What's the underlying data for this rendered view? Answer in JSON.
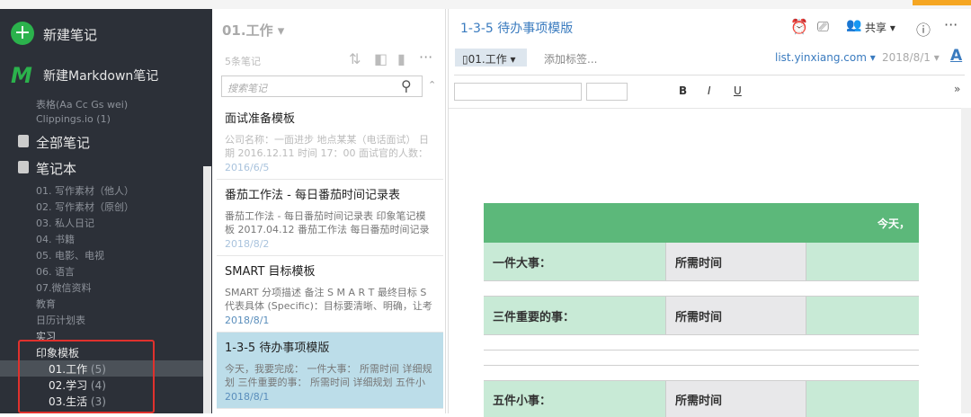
{
  "sidebar": {
    "new_note": "新建笔记",
    "new_markdown": "新建Markdown笔记",
    "shortcuts": [
      "表格(Aa Cc Gs wei)",
      "Clippings.io (1)"
    ],
    "all_notes": "全部笔记",
    "notebooks_label": "笔记本",
    "notebooks": [
      "01. 写作素材（他人）",
      "02. 写作素材（原创）",
      "03. 私人日记",
      "04. 书籍",
      "05. 电影、电视",
      "06. 语言",
      "07.微信资料",
      "教育",
      "日历计划表",
      "实习"
    ],
    "stack": {
      "name": "印象模板",
      "items": [
        {
          "name": "01.工作",
          "count": "(5)"
        },
        {
          "name": "02.学习",
          "count": "(4)"
        },
        {
          "name": "03.生活",
          "count": "(3)"
        }
      ]
    }
  },
  "list": {
    "title": "01.工作 ▾",
    "count": "5条笔记",
    "search_placeholder": "搜索笔记",
    "notes": [
      {
        "title": "面试准备模板",
        "snippet": "公司名称：一面进步 地点某某（电话面试） 日期 2016.12.11 时间 17：00 面试官的人数：太梦卷...",
        "date": "2016/6/5"
      },
      {
        "title": "番茄工作法 - 每日番茄时间记录表",
        "snippet": "番茄工作法 - 每日番茄时间记录表 印象笔记模板 2017.04.12 番茄工作法 每日番茄时间记录表 by ...",
        "date": "2018/8/2"
      },
      {
        "title": "SMART 目标模板",
        "snippet": "SMART 分项描述 备注 S M A R T 最终目标 S 代表具体 (Specific)：目标要清晰、明确，让考核者...",
        "date": "2018/8/1"
      },
      {
        "title": "1-3-5 待办事项模版",
        "snippet": "今天，我要完成： 一件大事： 所需时间 详细规划 三件重要的事： 所需时间 详细规划 五件小事： ...",
        "date": "2018/8/1"
      }
    ]
  },
  "editor": {
    "title": "1-3-5 待办事项模版",
    "share": "共享",
    "notebook": "01.工作 ▾",
    "add_tag": "添加标签...",
    "source": "list.yinxiang.com ▾",
    "date": "2018/8/1 ▾",
    "font_icon": "A",
    "fmt": [
      "B",
      "I",
      "U"
    ],
    "table": {
      "header": "今天，",
      "rows": [
        "一件大事：",
        "三件重要的事：",
        "五件小事："
      ],
      "time": "所需时间"
    }
  },
  "colors": {
    "accent": "#3a7bbf",
    "green": "#5cb87a",
    "sel": "#bcdde9"
  }
}
